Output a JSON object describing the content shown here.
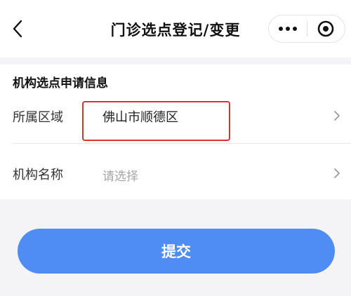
{
  "navbar": {
    "title": "门诊选点登记/变更",
    "back_icon": "chevron-left-icon",
    "more_icon": "more-dots-icon",
    "close_icon": "target-circle-icon"
  },
  "form": {
    "section_title": "机构选点申请信息",
    "fields": [
      {
        "label": "所属区域",
        "value": "佛山市顺德区",
        "placeholder": ""
      },
      {
        "label": "机构名称",
        "value": "",
        "placeholder": "请选择"
      }
    ],
    "highlight_color": "#d9352c"
  },
  "submit": {
    "label": "提交",
    "color": "#4f8df4"
  }
}
